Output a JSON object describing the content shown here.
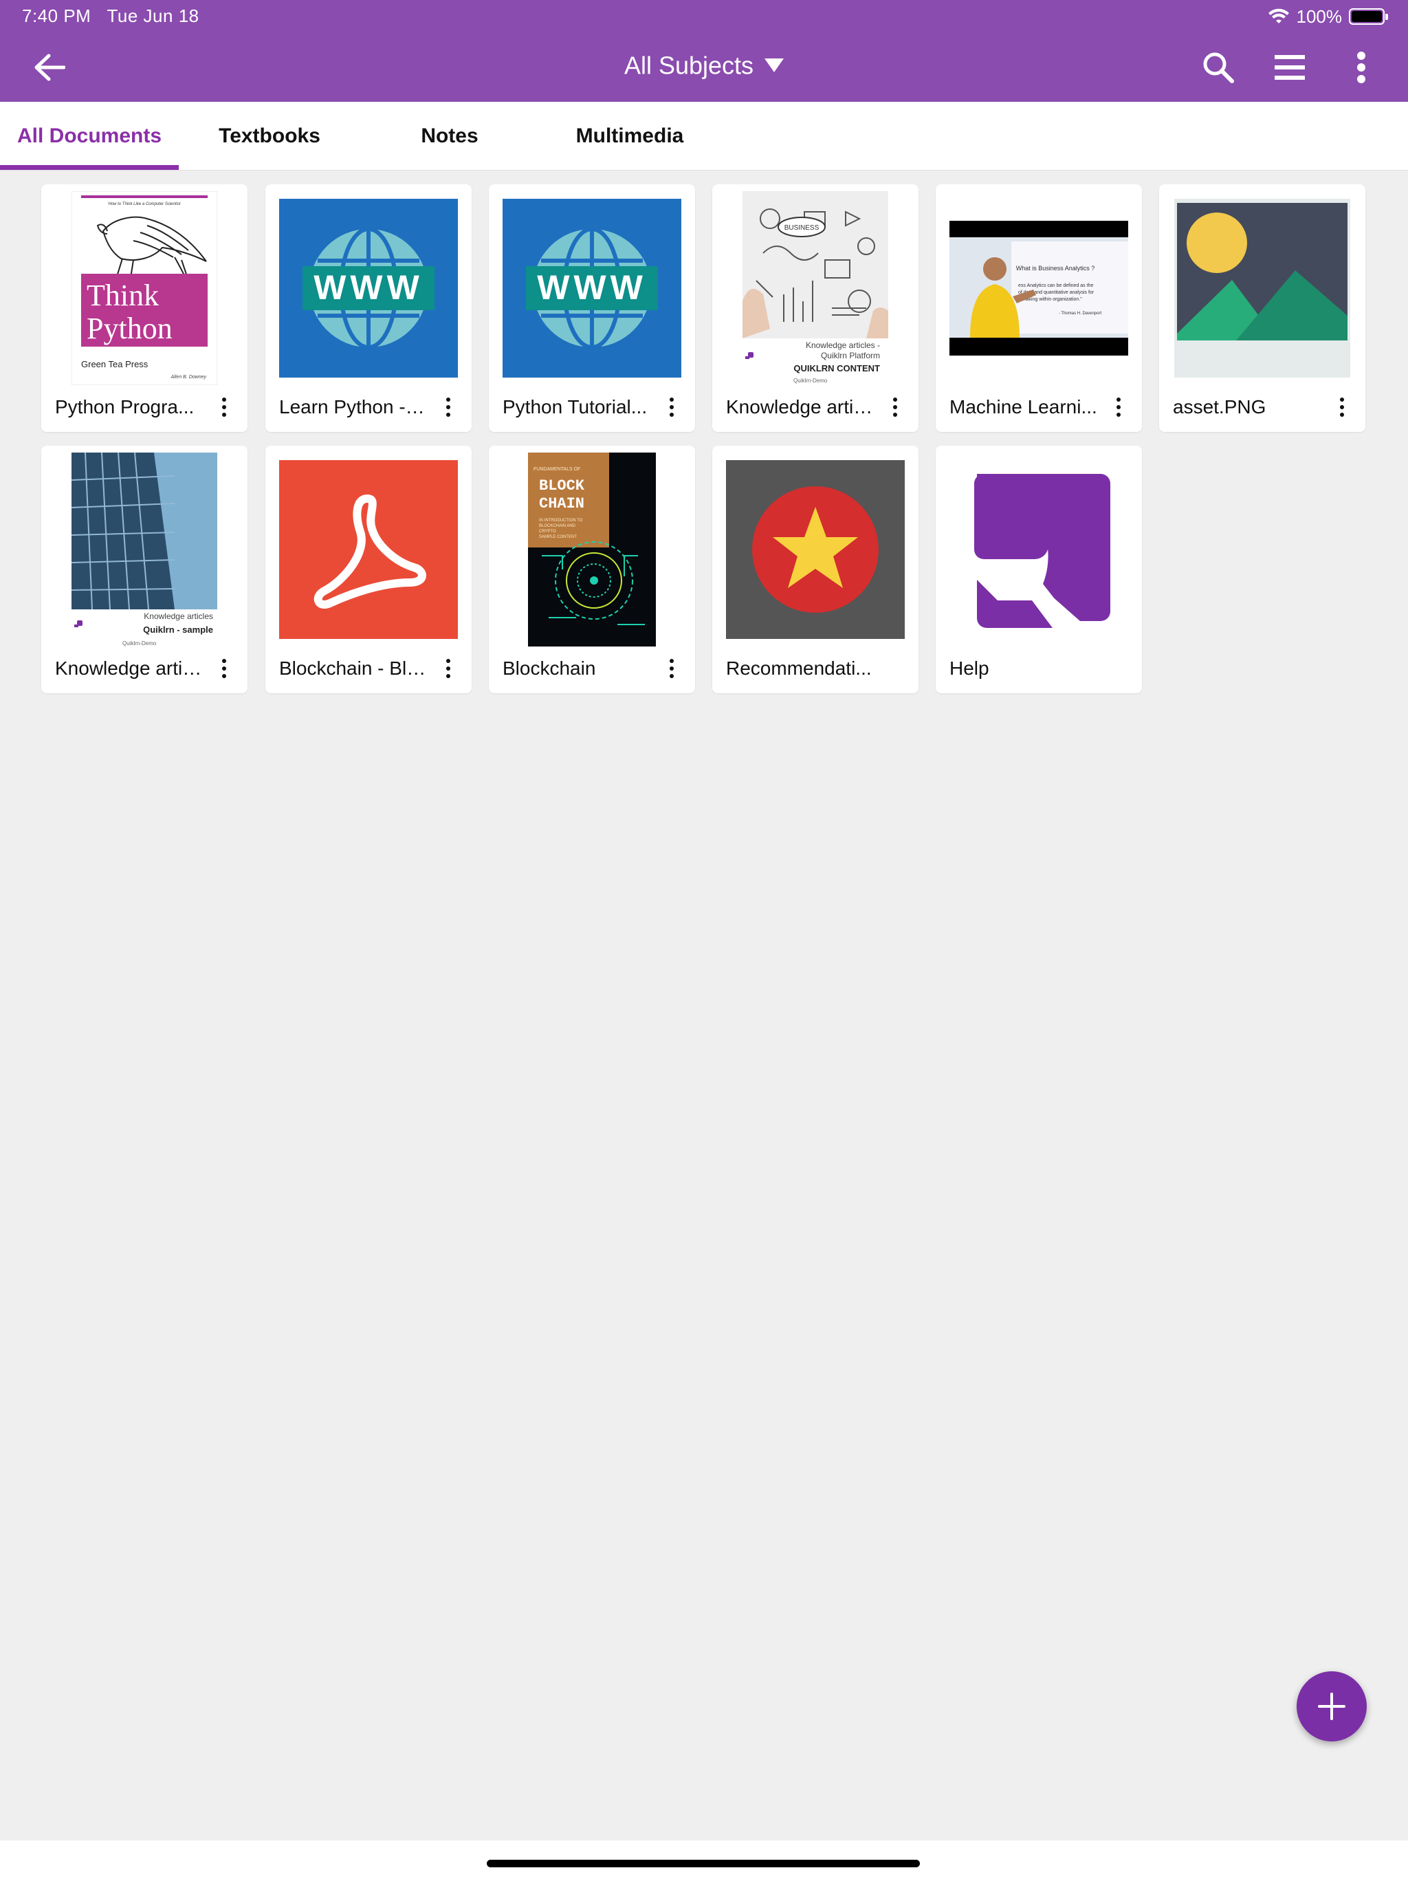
{
  "status_bar": {
    "time": "7:40 PM",
    "date": "Tue Jun 18",
    "battery": "100%"
  },
  "app_bar": {
    "back_icon": "arrow-left-icon",
    "title": "All Subjects",
    "actions": [
      "search-icon",
      "hamburger-icon",
      "more-vertical-icon"
    ]
  },
  "tabs": [
    {
      "label": "All Documents",
      "active": true
    },
    {
      "label": "Textbooks",
      "active": false
    },
    {
      "label": "Notes",
      "active": false
    },
    {
      "label": "Multimedia",
      "active": false
    }
  ],
  "documents": [
    {
      "label": "Python Progra...",
      "thumbnail": "think-python-cover",
      "has_menu": true
    },
    {
      "label": "Learn Python - F...",
      "thumbnail": "www-globe-icon",
      "has_menu": true
    },
    {
      "label": "Python Tutorial...",
      "thumbnail": "www-globe-icon",
      "has_menu": true
    },
    {
      "label": "Knowledge artic...",
      "thumbnail": "business-sketch-image",
      "has_menu": true
    },
    {
      "label": "Machine Learni...",
      "thumbnail": "video-lecture-frame",
      "has_menu": true
    },
    {
      "label": "asset.PNG",
      "thumbnail": "image-placeholder-icon",
      "has_menu": true
    },
    {
      "label": "Knowledge artic...",
      "thumbnail": "building-photo",
      "has_menu": true
    },
    {
      "label": "Blockchain - Blu...",
      "thumbnail": "pdf-icon",
      "has_menu": true
    },
    {
      "label": "Blockchain",
      "thumbnail": "blockchain-cover",
      "has_menu": true
    },
    {
      "label": "Recommendati...",
      "thumbnail": "star-badge-icon",
      "has_menu": false
    },
    {
      "label": "Help",
      "thumbnail": "quiklrn-logo-icon",
      "has_menu": false
    }
  ],
  "thumbnail_text": {
    "think_python": {
      "tagline": "How to Think Like a Computer Scientist",
      "line1": "Think",
      "line2": "Python",
      "publisher": "Green Tea Press",
      "author": "Allen B. Downey"
    },
    "knowledge_1": {
      "caption1": "Knowledge articles -",
      "caption2": "Quiklrn Platform",
      "caption3": "QUIKLRN CONTENT",
      "caption4": "Quiklrn-Demo",
      "bubble": "BUSINESS"
    },
    "video": {
      "heading": "What is Business Analytics ?",
      "body1": "ess Analytics can be defined as the",
      "body2": "of data and quantitative analysis for",
      "body3": "n making within organization.\"",
      "credit": "- Thomas H. Davenport"
    },
    "knowledge_2": {
      "caption1": "Knowledge articles",
      "caption2": "Quiklrn - sample",
      "caption3": "Quiklrn-Demo"
    },
    "blockchain": {
      "line0": "FUNDAMENTALS OF",
      "line1": "BLOCK",
      "line2": "CHAIN",
      "sub1": "IN INTRODUCTION TO",
      "sub2": "BLOCKCHAIN AND",
      "sub3": "CRYPTO",
      "sub4": "SAMPLE CONTENT"
    },
    "www": "WWW"
  },
  "colors": {
    "app_bar": "#8a4caf",
    "accent": "#8a2fa8",
    "fab": "#7b2fa6",
    "background": "#efefef"
  },
  "fab": {
    "icon": "plus-icon"
  }
}
